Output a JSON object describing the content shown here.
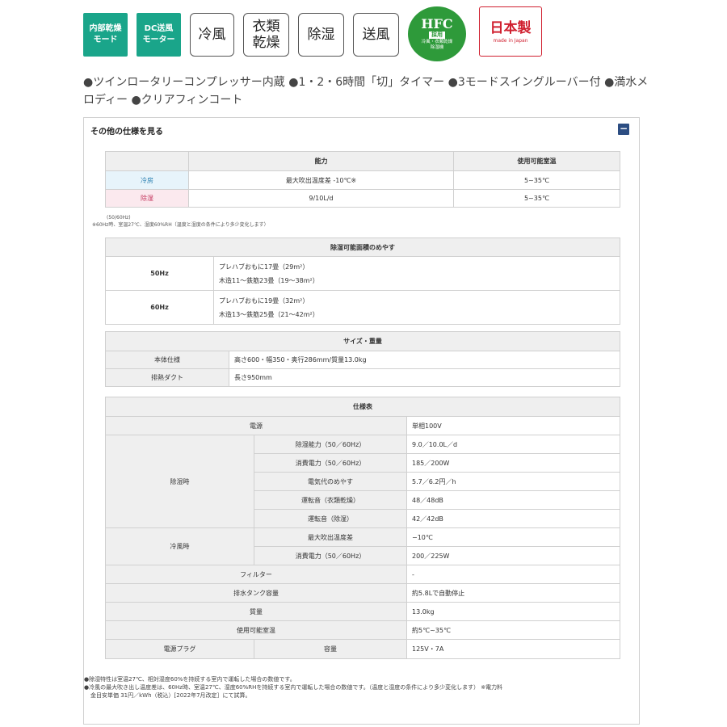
{
  "badges": [
    {
      "line1": "内部乾燥",
      "line2": "モード"
    },
    {
      "line1": "DC送風",
      "line2": "モーター"
    },
    {
      "line1": "冷風",
      "line2": ""
    },
    {
      "line1": "衣類",
      "line2": "乾燥"
    },
    {
      "line1": "除湿",
      "line2": ""
    },
    {
      "line1": "送風",
      "line2": ""
    }
  ],
  "hfc_badge": {
    "top": "HFC",
    "mid": "採用",
    "bot1": "冷風・衣類乾燥",
    "bot2": "除湿機"
  },
  "japan_badge": {
    "main": "日本製",
    "sub": "made in Japan"
  },
  "features_text": "●ツインロータリーコンプレッサー内蔵 ●1・2・6時間「切」タイマー ●3モードスイングルーバー付 ●満水メロディー ●クリアフィンコート",
  "panel": {
    "title": "その他の仕様を見る",
    "toggle": "−"
  },
  "ability_table": {
    "headers": [
      "",
      "能力",
      "使用可能室温"
    ],
    "rows": [
      {
        "mode": "冷房",
        "ability": "最大吹出温度差 -10℃※",
        "temp": "5~35℃"
      },
      {
        "mode": "除湿",
        "ability": "9/10L/d",
        "temp": "5~35℃"
      }
    ],
    "note1": "(50/60Hz)",
    "note2": "※60Hz時、室温27℃、湿度60%RH（温度と湿度の条件により多少変化します）"
  },
  "area_table": {
    "title": "除湿可能面積のめやす",
    "rows": [
      {
        "hz": "50Hz",
        "line1": "プレハブおもに17畳（29m²）",
        "line2": "木造11～鉄筋23畳（19～38m²）"
      },
      {
        "hz": "60Hz",
        "line1": "プレハブおもに19畳（32m²）",
        "line2": "木造13～鉄筋25畳（21～42m²）"
      }
    ]
  },
  "size_table": {
    "title": "サイズ・重量",
    "rows": [
      {
        "label": "本体仕様",
        "value": "高さ600・幅350・奥行286mm/質量13.0kg"
      },
      {
        "label": "排熱ダクト",
        "value": "長さ950mm"
      }
    ]
  },
  "spec_table": {
    "title": "仕様表",
    "power": {
      "label": "電源",
      "value": "単相100V"
    },
    "dehumid": {
      "group": "除湿時",
      "rows": [
        {
          "label": "除湿能力（50／60Hz）",
          "value": "9.0／10.0L／d"
        },
        {
          "label": "消費電力（50／60Hz）",
          "value": "185／200W"
        },
        {
          "label": "電気代のめやす",
          "value": "5.7／6.2円／h"
        },
        {
          "label": "運転音（衣類乾燥）",
          "value": "48／48dB"
        },
        {
          "label": "運転音（除湿）",
          "value": "42／42dB"
        }
      ]
    },
    "cool": {
      "group": "冷風時",
      "rows": [
        {
          "label": "最大吹出温度差",
          "value": "−10℃"
        },
        {
          "label": "消費電力（50／60Hz）",
          "value": "200／225W"
        }
      ]
    },
    "filter": {
      "label": "フィルター",
      "value": "-"
    },
    "tank": {
      "label": "排水タンク容量",
      "value": "約5.8Lで自動停止"
    },
    "weight": {
      "label": "質量",
      "value": "13.0kg"
    },
    "room_temp": {
      "label": "使用可能室温",
      "value": "約5℃~35℃"
    },
    "plug": {
      "label": "電源プラグ",
      "sub": "容量",
      "value": "125V・7A"
    }
  },
  "footnotes": {
    "line1": "●除湿特性は室温27℃、相対湿度60%を持続する室内で運転した場合の数値です。",
    "line2": "●冷風の最大吹き出し温度差は、60Hz時、室温27℃、湿度60%RHを持続する室内で運転した場合の数値です。（温度と湿度の条件により多少変化します） ※電力料",
    "line3": "金目安単価 31円／kWh（税込）[2022年7月改定］にて試算。"
  }
}
